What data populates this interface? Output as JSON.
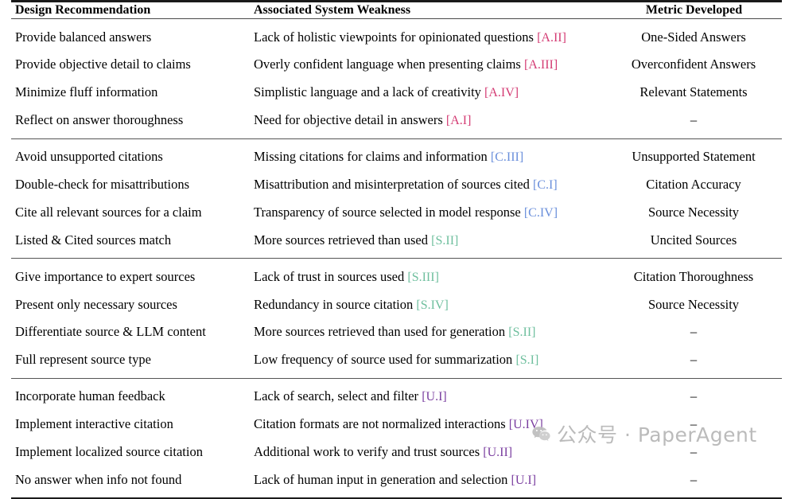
{
  "table": {
    "headers": {
      "recommendation": "Design Recommendation",
      "weakness": "Associated System Weakness",
      "metric": "Metric Developed"
    },
    "tag_colors": {
      "A": "#d43c74",
      "C": "#6a8fdb",
      "S": "#6fbf9e",
      "U": "#7b3fa0"
    },
    "empty_metric": "–",
    "groups": [
      {
        "id": "answer-quality",
        "rows": [
          {
            "recommendation": "Provide balanced answers",
            "weakness_text": "Lack of holistic viewpoints for opinionated questions",
            "weakness_tag": "[A.II]",
            "weakness_tag_group": "A",
            "metric": "One-Sided Answers"
          },
          {
            "recommendation": "Provide objective detail to claims",
            "weakness_text": "Overly confident language when presenting claims",
            "weakness_tag": "[A.III]",
            "weakness_tag_group": "A",
            "metric": "Overconfident Answers"
          },
          {
            "recommendation": "Minimize fluff information",
            "weakness_text": "Simplistic language and a lack of creativity",
            "weakness_tag": "[A.IV]",
            "weakness_tag_group": "A",
            "metric": "Relevant Statements"
          },
          {
            "recommendation": "Reflect on answer thoroughness",
            "weakness_text": "Need for objective detail in answers",
            "weakness_tag": "[A.I]",
            "weakness_tag_group": "A",
            "metric": "–"
          }
        ]
      },
      {
        "id": "citation",
        "rows": [
          {
            "recommendation": "Avoid unsupported citations",
            "weakness_text": "Missing citations for claims and information",
            "weakness_tag": "[C.III]",
            "weakness_tag_group": "C",
            "metric": "Unsupported Statement"
          },
          {
            "recommendation": "Double-check for misattributions",
            "weakness_text": "Misattribution and misinterpretation of sources cited",
            "weakness_tag": "[C.I]",
            "weakness_tag_group": "C",
            "metric": "Citation Accuracy"
          },
          {
            "recommendation": "Cite all relevant sources for a claim",
            "weakness_text": "Transparency of source selected in model response",
            "weakness_tag": "[C.IV]",
            "weakness_tag_group": "C",
            "metric": "Source Necessity"
          },
          {
            "recommendation": "Listed & Cited sources match",
            "weakness_text": "More sources retrieved than used",
            "weakness_tag": "[S.II]",
            "weakness_tag_group": "S",
            "metric": "Uncited Sources"
          }
        ]
      },
      {
        "id": "sources",
        "rows": [
          {
            "recommendation": "Give importance to expert sources",
            "weakness_text": "Lack of trust in sources used",
            "weakness_tag": "[S.III]",
            "weakness_tag_group": "S",
            "metric": "Citation Thoroughness"
          },
          {
            "recommendation": "Present only necessary sources",
            "weakness_text": "Redundancy in source citation",
            "weakness_tag": "[S.IV]",
            "weakness_tag_group": "S",
            "metric": "Source Necessity"
          },
          {
            "recommendation": "Differentiate source & LLM content",
            "weakness_text": "More sources retrieved than used for generation",
            "weakness_tag": "[S.II]",
            "weakness_tag_group": "S",
            "metric": "–"
          },
          {
            "recommendation": "Full represent source type",
            "weakness_text": "Low frequency of source used for summarization",
            "weakness_tag": "[S.I]",
            "weakness_tag_group": "S",
            "metric": "–"
          }
        ]
      },
      {
        "id": "user-interaction",
        "rows": [
          {
            "recommendation": "Incorporate human feedback",
            "weakness_text": "Lack of search, select and filter",
            "weakness_tag": "[U.I]",
            "weakness_tag_group": "U",
            "metric": "–"
          },
          {
            "recommendation": "Implement interactive citation",
            "weakness_text": "Citation formats are not normalized interactions",
            "weakness_tag": "[U.IV]",
            "weakness_tag_group": "U",
            "metric": "–"
          },
          {
            "recommendation": "Implement localized source citation",
            "weakness_text": "Additional work to verify and trust sources",
            "weakness_tag": "[U.II]",
            "weakness_tag_group": "U",
            "metric": "–"
          },
          {
            "recommendation": "No answer when info not found",
            "weakness_text": "Lack of human input in generation and selection",
            "weakness_tag": "[U.I]",
            "weakness_tag_group": "U",
            "metric": "–"
          }
        ]
      }
    ]
  },
  "watermark": {
    "text": "公众号 · PaperAgent",
    "icon": "wechat-icon",
    "color": "#b6b6b6"
  }
}
